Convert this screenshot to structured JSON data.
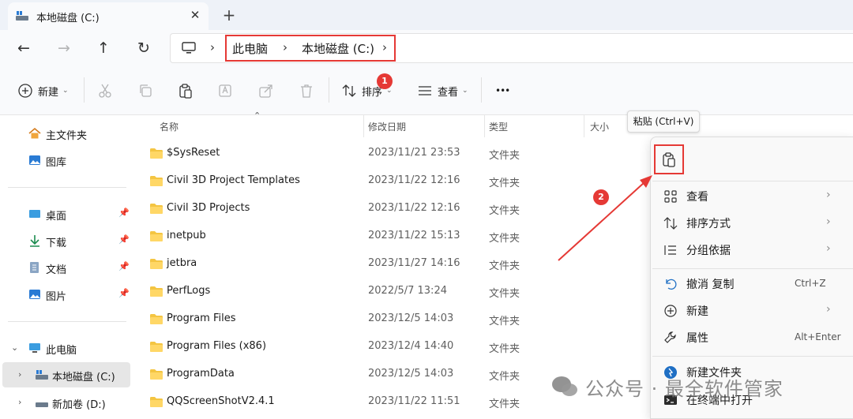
{
  "tab": {
    "title": "本地磁盘 (C:)",
    "close": "✕",
    "new_tab": "+"
  },
  "nav": {
    "back": "←",
    "forward": "→",
    "up": "↑",
    "refresh": "↻"
  },
  "breadcrumb": {
    "items": [
      "此电脑",
      "本地磁盘 (C:)"
    ],
    "sep": "›"
  },
  "toolbar": {
    "new_label": "新建",
    "sort_label": "排序",
    "view_label": "查看",
    "more": "•••",
    "step1": "1"
  },
  "sidebar": {
    "items": [
      {
        "label": "主文件夹"
      },
      {
        "label": "图库"
      },
      {
        "label": "桌面"
      },
      {
        "label": "下载"
      },
      {
        "label": "文档"
      },
      {
        "label": "图片"
      },
      {
        "label": "此电脑"
      },
      {
        "label": "本地磁盘 (C:)"
      },
      {
        "label": "新加卷 (D:)"
      }
    ]
  },
  "columns": {
    "name": "名称",
    "date": "修改日期",
    "type": "类型",
    "size": "大小"
  },
  "files": [
    {
      "name": "$SysReset",
      "date": "2023/11/21 23:53",
      "type": "文件夹"
    },
    {
      "name": "Civil 3D Project Templates",
      "date": "2023/11/22 12:16",
      "type": "文件夹"
    },
    {
      "name": "Civil 3D Projects",
      "date": "2023/11/22 12:16",
      "type": "文件夹"
    },
    {
      "name": "inetpub",
      "date": "2023/11/22 15:13",
      "type": "文件夹"
    },
    {
      "name": "jetbra",
      "date": "2023/11/27 14:16",
      "type": "文件夹"
    },
    {
      "name": "PerfLogs",
      "date": "2022/5/7 13:24",
      "type": "文件夹"
    },
    {
      "name": "Program Files",
      "date": "2023/12/5 14:03",
      "type": "文件夹"
    },
    {
      "name": "Program Files (x86)",
      "date": "2023/12/4 14:40",
      "type": "文件夹"
    },
    {
      "name": "ProgramData",
      "date": "2023/12/5 14:03",
      "type": "文件夹"
    },
    {
      "name": "QQScreenShotV2.4.1",
      "date": "2023/11/22 11:51",
      "type": "文件夹"
    }
  ],
  "tooltip": "粘贴 (Ctrl+V)",
  "step2": "2",
  "menu": {
    "items": [
      {
        "label": "查看",
        "shortcut": "",
        "arrow": "›"
      },
      {
        "label": "排序方式",
        "shortcut": "",
        "arrow": "›"
      },
      {
        "label": "分组依据",
        "shortcut": "",
        "arrow": "›"
      },
      {
        "label": "撤消 复制",
        "shortcut": "Ctrl+Z",
        "arrow": ""
      },
      {
        "label": "新建",
        "shortcut": "",
        "arrow": "›"
      },
      {
        "label": "属性",
        "shortcut": "Alt+Enter",
        "arrow": ""
      },
      {
        "label": "新建文件夹",
        "shortcut": "",
        "arrow": ""
      },
      {
        "label": "在终端中打开",
        "shortcut": "",
        "arrow": ""
      }
    ]
  },
  "watermark": "公众号 · 最全软件管家",
  "colors": {
    "accent": "#0067c0",
    "highlight": "#e53935",
    "folder": "#f4c542"
  }
}
